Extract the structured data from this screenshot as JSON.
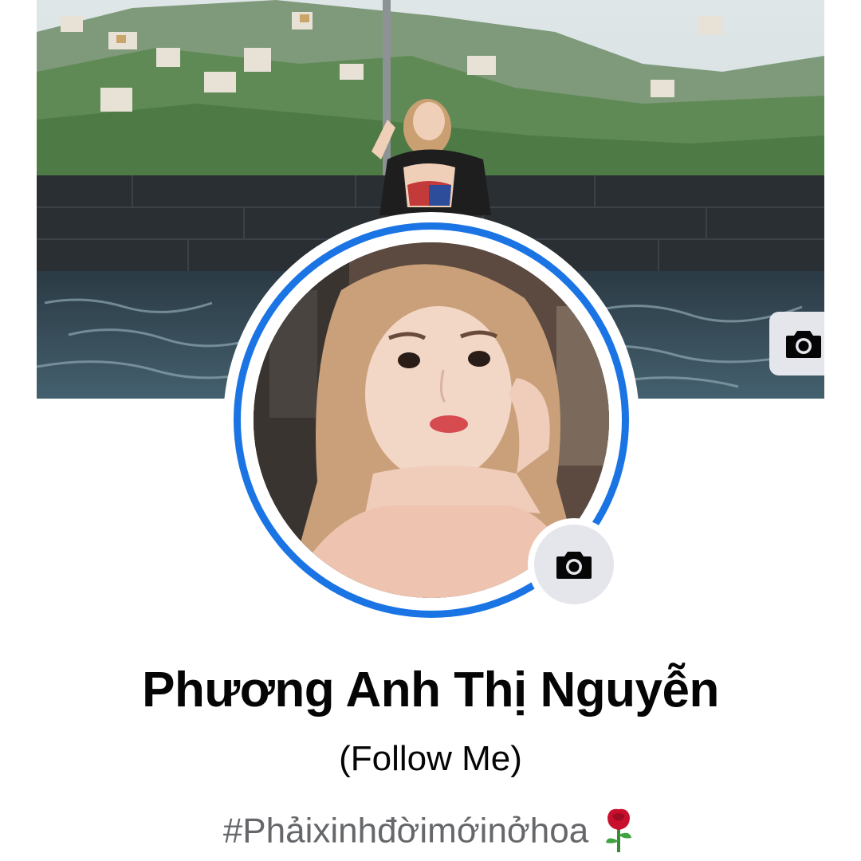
{
  "profile": {
    "name": "Phương Anh Thị Nguyễn",
    "subtitle": "(Follow Me)",
    "bio": "#Phảixinhđờimớinởhoa",
    "bio_emoji": "rose-emoji"
  },
  "icons": {
    "cover_camera": "camera-icon",
    "avatar_camera": "camera-icon"
  },
  "colors": {
    "accent_ring": "#1b74e4",
    "button_bg": "#e4e6eb",
    "name_text": "#050505",
    "bio_text": "#65676b"
  }
}
